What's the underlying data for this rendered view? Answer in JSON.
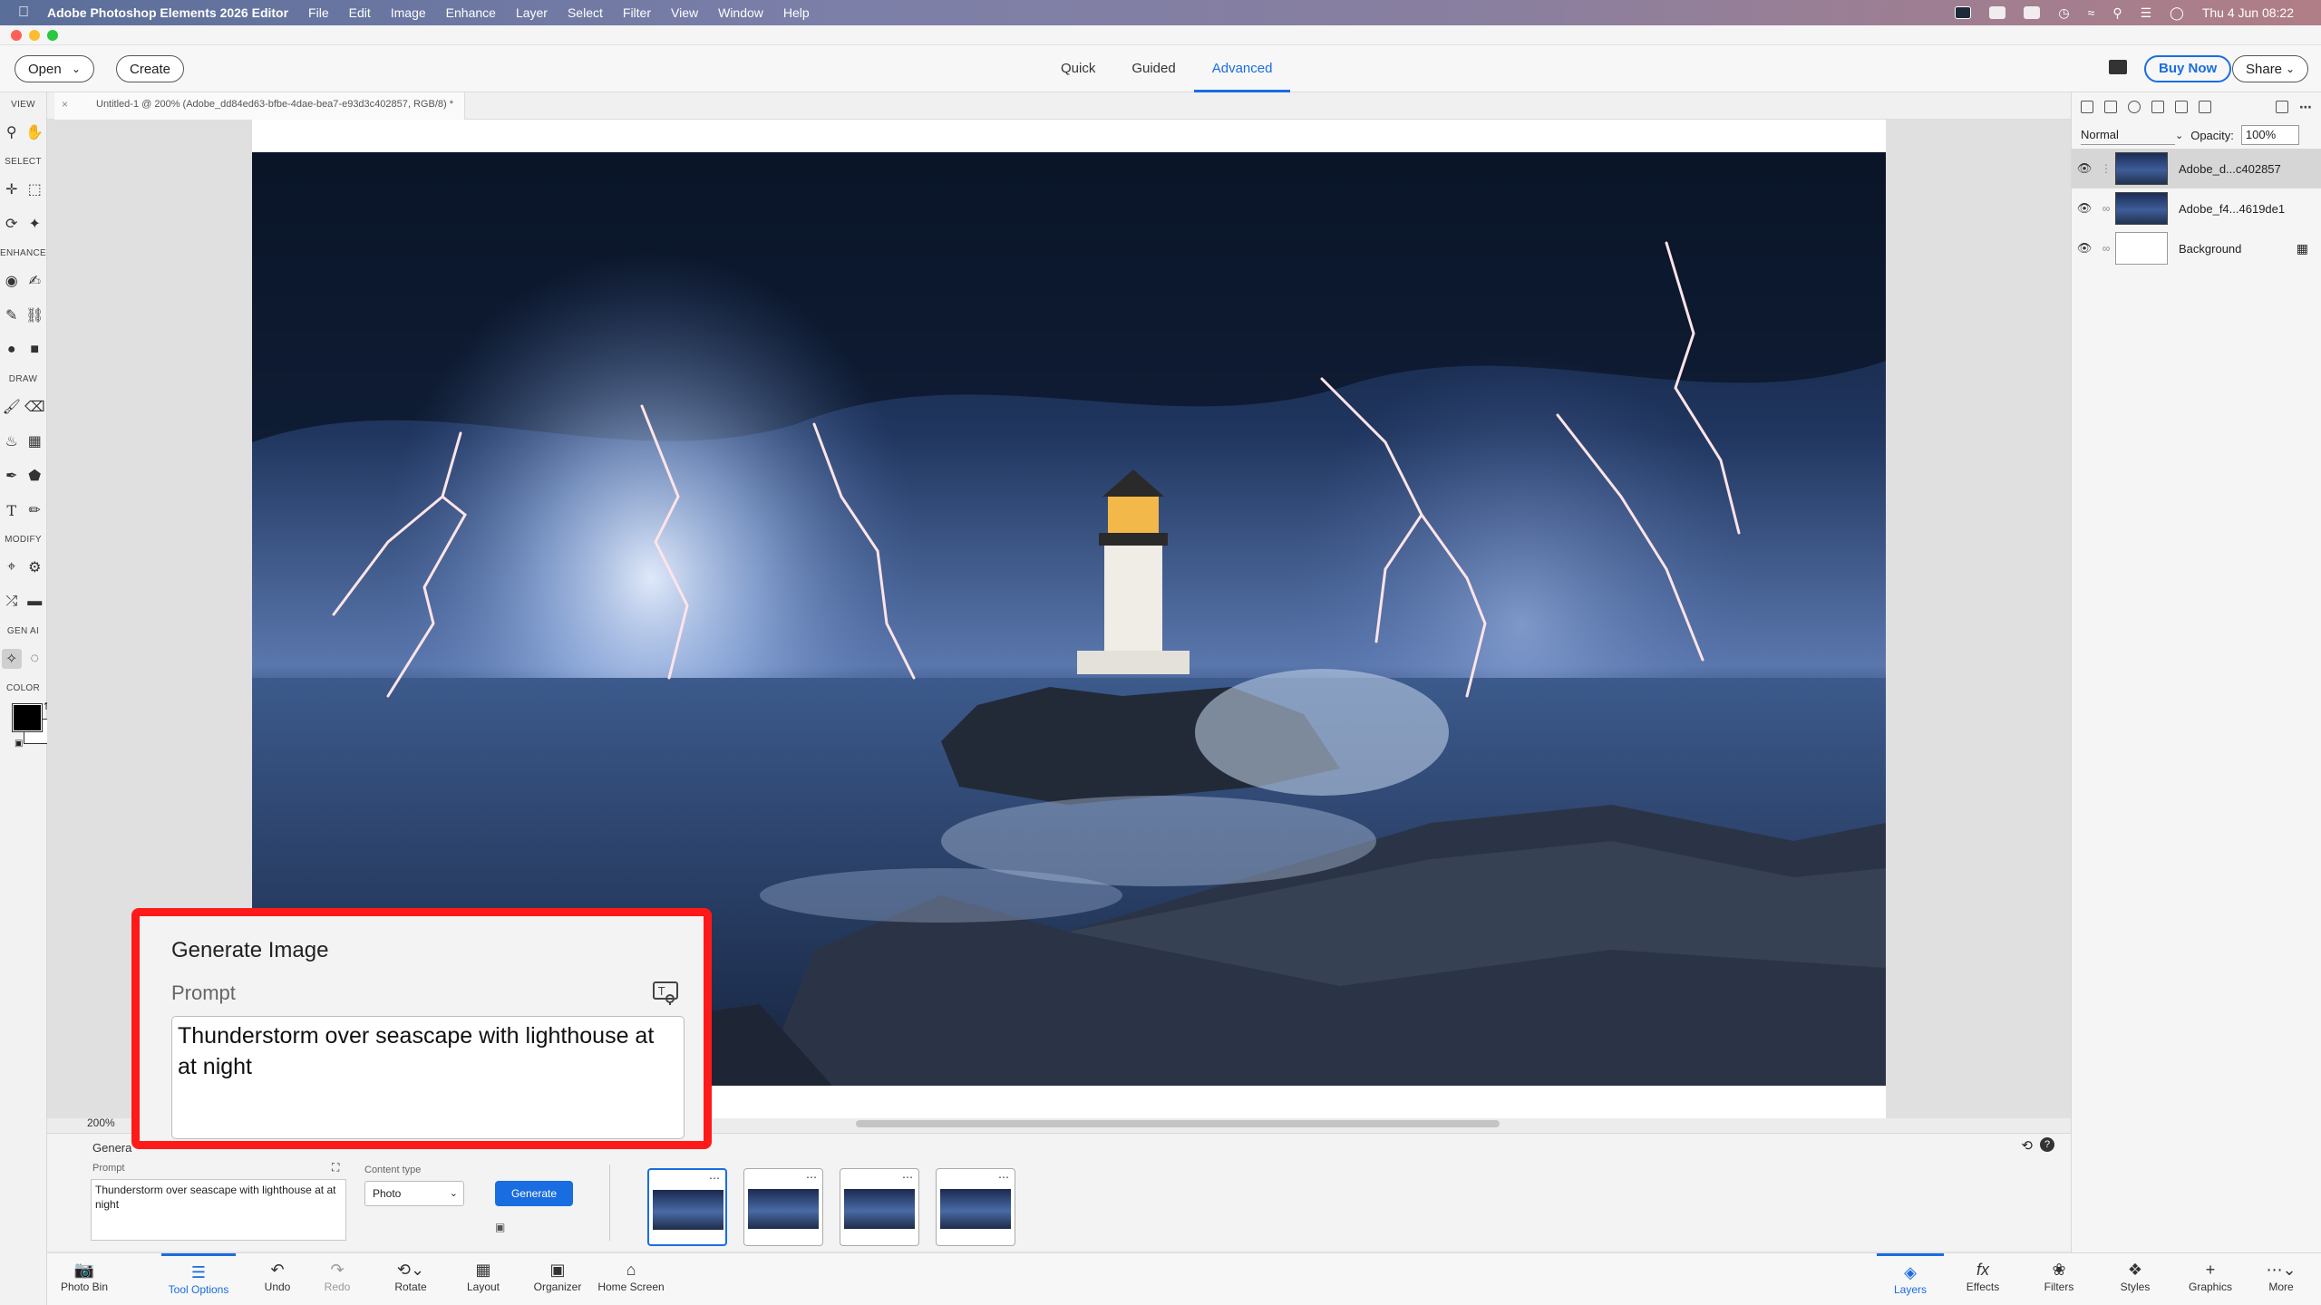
{
  "menubar": {
    "app_name": "Adobe Photoshop Elements 2026 Editor",
    "items": [
      "File",
      "Edit",
      "Image",
      "Enhance",
      "Layer",
      "Select",
      "Filter",
      "View",
      "Window",
      "Help"
    ],
    "clock": "Thu 4 Jun  08:22"
  },
  "toolbar": {
    "open_label": "Open",
    "create_label": "Create",
    "modes": [
      {
        "label": "Quick"
      },
      {
        "label": "Guided"
      },
      {
        "label": "Advanced"
      }
    ],
    "buy_now_label": "Buy Now",
    "share_label": "Share"
  },
  "document": {
    "tab_title": "Untitled-1 @ 200% (Adobe_dd84ed63-bfbe-4dae-bea7-e93d3c402857, RGB/8) *",
    "zoom": "200%"
  },
  "tool_sections": {
    "view": "VIEW",
    "select": "SELECT",
    "enhance": "ENHANCE",
    "draw": "DRAW",
    "modify": "MODIFY",
    "genai": "GEN AI",
    "color": "COLOR"
  },
  "layers_panel": {
    "blend_mode": "Normal",
    "opacity_label": "Opacity:",
    "opacity_value": "100%",
    "layers": [
      {
        "name": "Adobe_d...c402857"
      },
      {
        "name": "Adobe_f4...4619de1"
      },
      {
        "name": "Background"
      }
    ]
  },
  "tool_options": {
    "header": "Genera",
    "prompt_label": "Prompt",
    "prompt_text": "Thunderstorm over seascape with lighthouse at at night",
    "content_type_label": "Content type",
    "content_type_value": "Photo",
    "generate_label": "Generate"
  },
  "taskbar": {
    "left": [
      {
        "label": "Photo Bin",
        "icon": "photo-bin-icon"
      },
      {
        "label": "Tool Options",
        "icon": "tool-options-icon"
      },
      {
        "label": "Undo",
        "icon": "undo-icon"
      },
      {
        "label": "Redo",
        "icon": "redo-icon"
      },
      {
        "label": "Rotate",
        "icon": "rotate-icon"
      },
      {
        "label": "Layout",
        "icon": "layout-icon"
      },
      {
        "label": "Organizer",
        "icon": "organizer-icon"
      },
      {
        "label": "Home Screen",
        "icon": "home-icon"
      }
    ],
    "right": [
      {
        "label": "Layers",
        "icon": "layers-icon"
      },
      {
        "label": "Effects",
        "icon": "effects-icon"
      },
      {
        "label": "Filters",
        "icon": "filters-icon"
      },
      {
        "label": "Styles",
        "icon": "styles-icon"
      },
      {
        "label": "Graphics",
        "icon": "graphics-icon"
      },
      {
        "label": "More",
        "icon": "more-icon"
      }
    ]
  },
  "callout": {
    "title": "Generate Image",
    "prompt_label": "Prompt",
    "prompt_text": "Thunderstorm over seascape with lighthouse at at night",
    "border_color": "#ff1a1a"
  },
  "colors": {
    "accent": "#1a6de0",
    "foreground_swatch": "#000000",
    "background_swatch": "#ffffff"
  }
}
